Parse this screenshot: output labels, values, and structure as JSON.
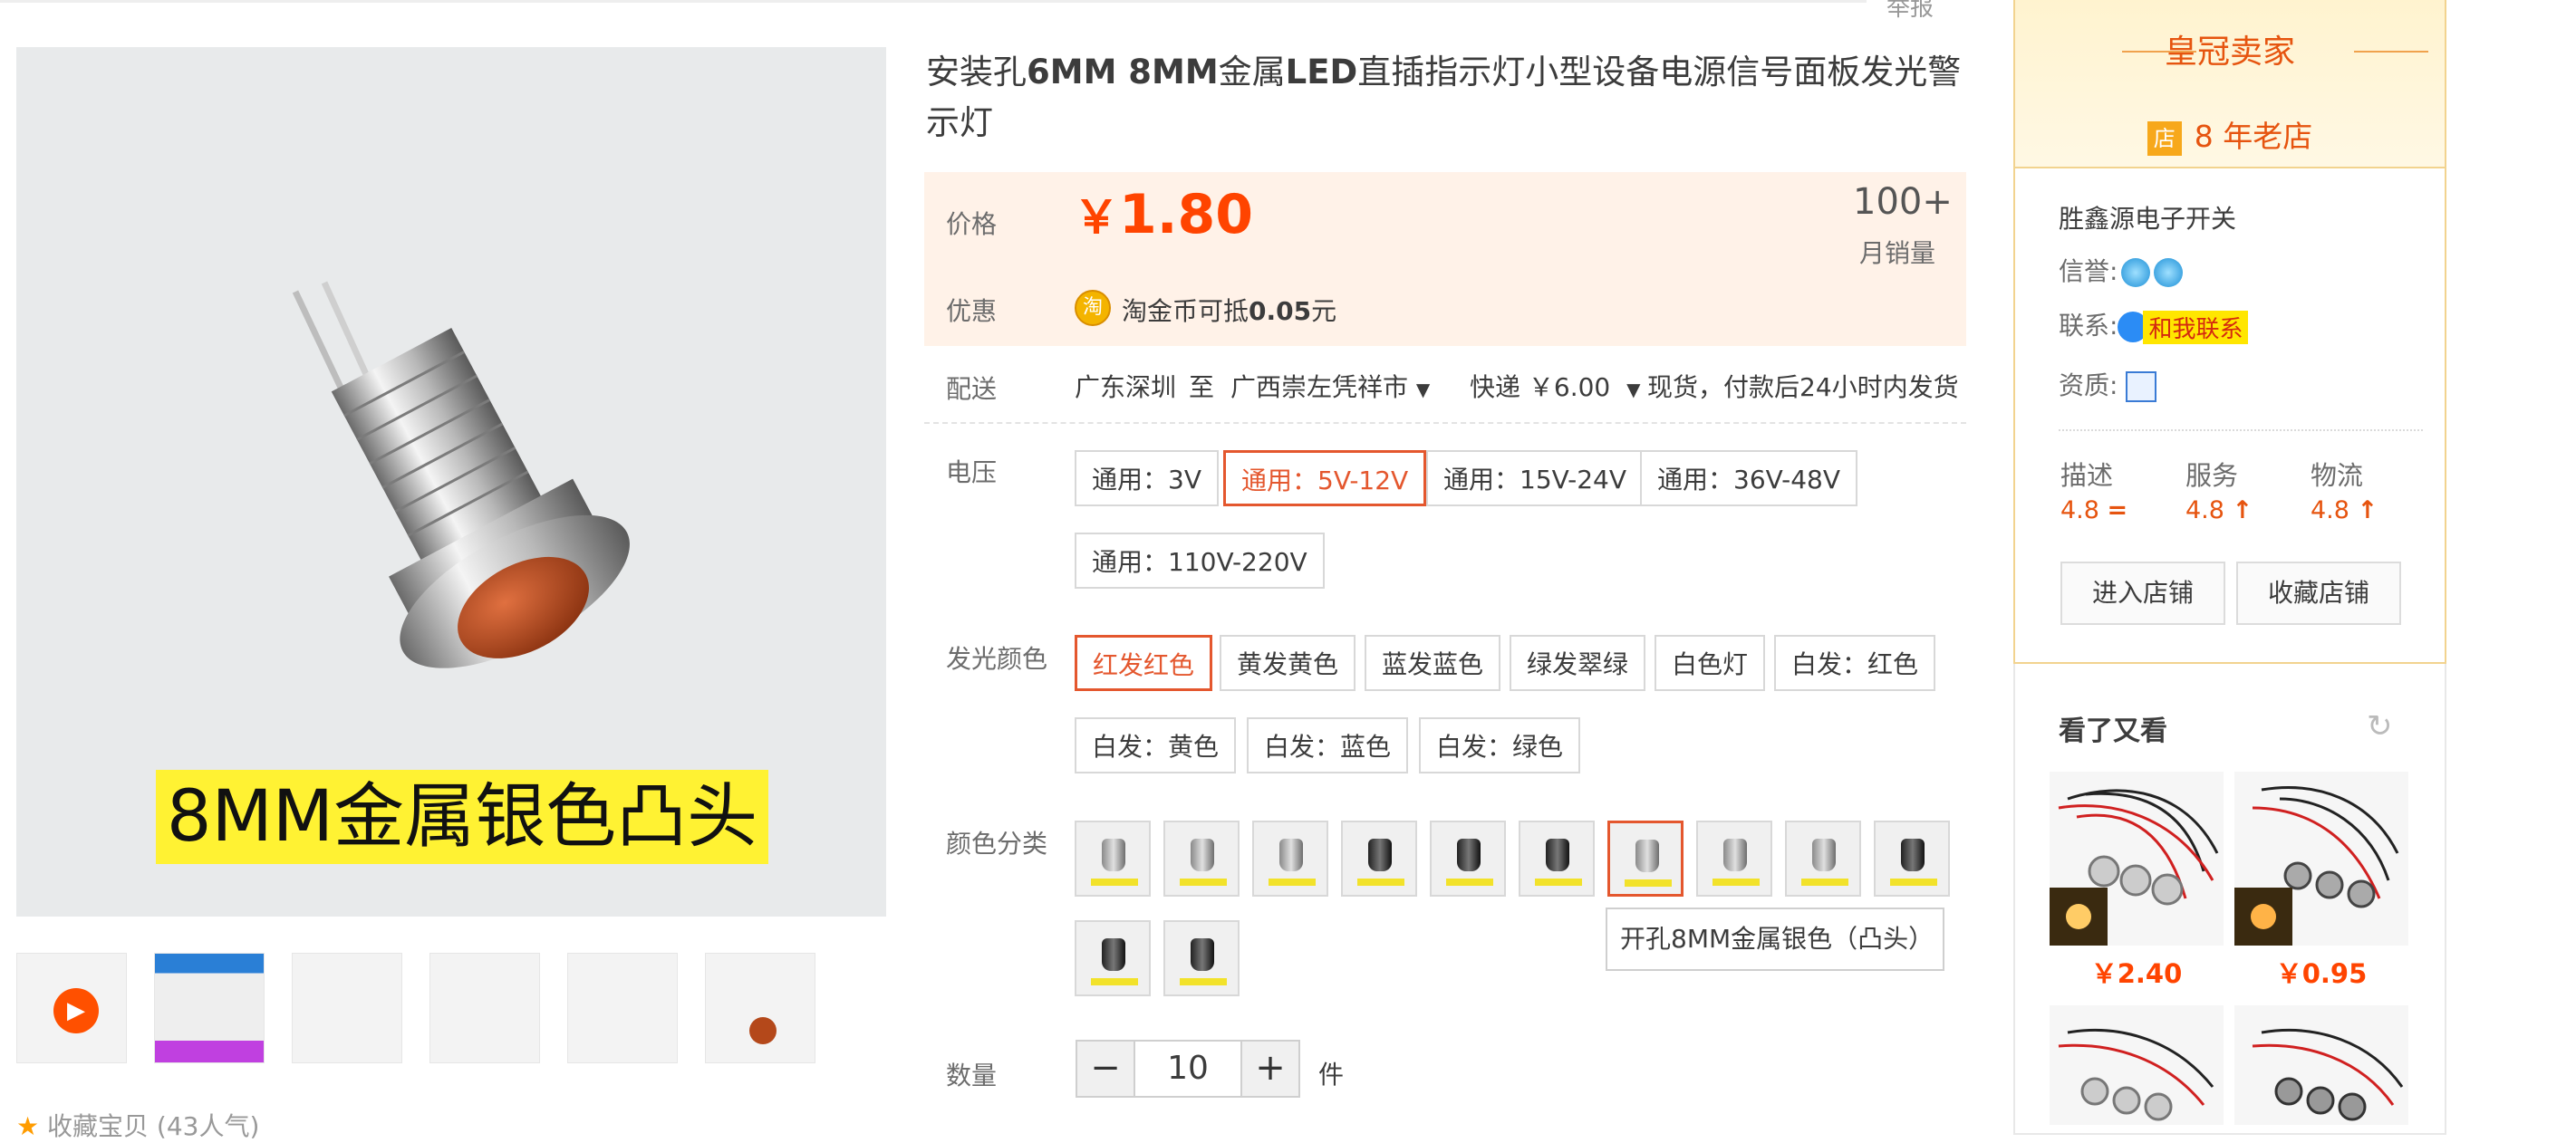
{
  "top": {
    "report_label": "举报"
  },
  "gallery": {
    "banner_text": "8MM金属银色凸头",
    "play_icon": "play-icon",
    "favorite_text": "收藏宝贝 (43人气)"
  },
  "product": {
    "title_parts": [
      "安装孔",
      "6MM 8MM",
      "金属",
      "LED",
      "直插指示灯小型设备电源信号面板发光警示灯"
    ],
    "price_label": "价格",
    "currency": "￥",
    "price": "1.80",
    "sales_count": "100+",
    "sales_label": "月销量",
    "promo_label": "优惠",
    "coin_icon_text": "淘",
    "promo_prefix": "淘金币可抵",
    "promo_value": "0.05",
    "promo_suffix": "元",
    "shipping_label": "配送",
    "ship_from": "广东深圳",
    "ship_to_word": "至",
    "ship_to": "广西崇左凭祥市",
    "express": "快递 ￥6.00",
    "ship_note": "现货，付款后24小时内发货"
  },
  "options": {
    "voltage_label": "电压",
    "voltage": [
      "通用：3V",
      "通用：5V-12V",
      "通用：15V-24V",
      "通用：36V-48V",
      "通用：110V-220V"
    ],
    "color_label": "发光颜色",
    "colors": [
      "红发红色",
      "黄发黄色",
      "蓝发蓝色",
      "绿发翠绿",
      "白色灯",
      "白发：红色",
      "白发：黄色",
      "白发：蓝色",
      "白发：绿色"
    ],
    "category_label": "颜色分类",
    "tooltip": "开孔8MM金属银色（凸头）",
    "qty_label": "数量",
    "qty_minus": "−",
    "qty_value": "10",
    "qty_plus": "+",
    "qty_unit": "件"
  },
  "seller": {
    "crown_title": "皇冠卖家",
    "shop_badge": "店",
    "years": "8 年老店",
    "shop_name": "胜鑫源电子开关",
    "credit_label": "信誉:",
    "contact_label": "联系:",
    "contact_button": "和我联系",
    "qual_label": "资质:",
    "scores": [
      {
        "label": "描述",
        "value": "4.8",
        "trend": "="
      },
      {
        "label": "服务",
        "value": "4.8",
        "trend": "↑"
      },
      {
        "label": "物流",
        "value": "4.8",
        "trend": "↑"
      }
    ],
    "enter_shop": "进入店铺",
    "fav_shop": "收藏店铺"
  },
  "also_viewed": {
    "title": "看了又看",
    "refresh_icon": "↻",
    "items": [
      {
        "price": "￥2.40"
      },
      {
        "price": "￥0.95"
      }
    ]
  },
  "colors": {
    "accent": "#ff4400",
    "selected_border": "#e4572e",
    "seller_orange": "#e6540f"
  }
}
